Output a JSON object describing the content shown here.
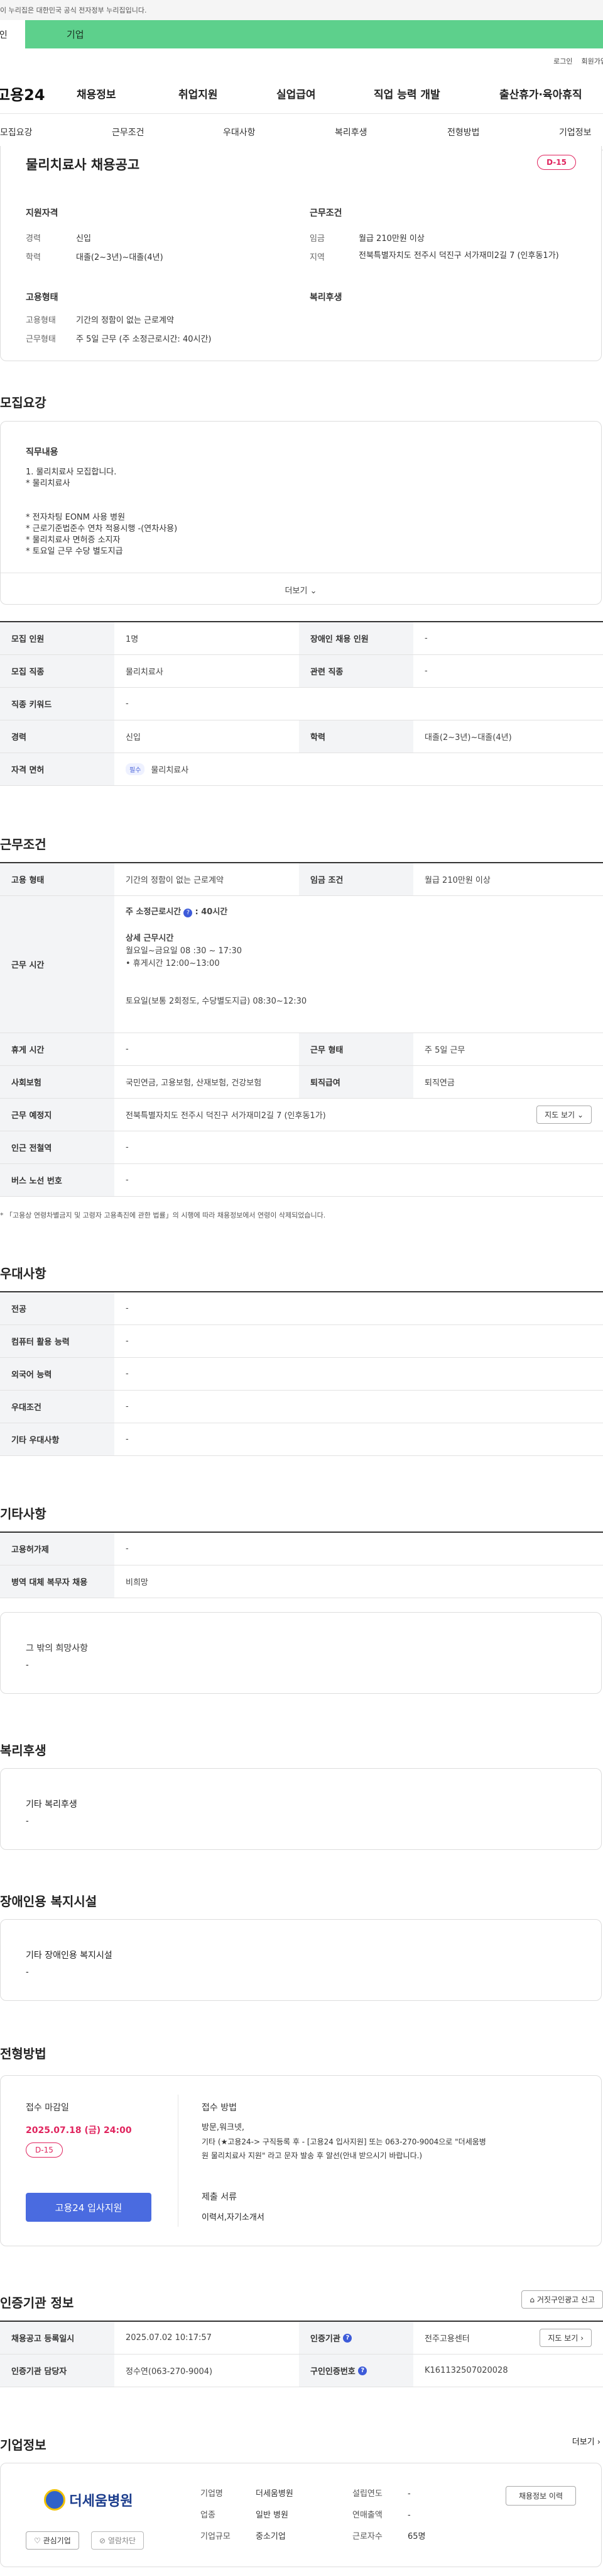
{
  "gov_notice": "이 누리집은 대한민국 공식 전자정부 누리집입니다.",
  "tabs": {
    "person": "개인",
    "business": "기업"
  },
  "util": {
    "login": "로그인",
    "join": "회원가입"
  },
  "logo": "고용24",
  "gnb": [
    "채용정보",
    "취업지원",
    "실업급여",
    "직업 능력 개발",
    "출산휴가·육아휴직"
  ],
  "anchors": [
    "모집요강",
    "근무조건",
    "우대사항",
    "복리후생",
    "전형방법",
    "기업정보"
  ],
  "summary": {
    "title": "물리치료사 채용공고",
    "dday": "D-15",
    "qual_title": "지원자격",
    "career_label": "경력",
    "career_value": "신입",
    "edu_label": "학력",
    "edu_value": "대졸(2~3년)~대졸(4년)",
    "cond_title": "근무조건",
    "wage_label": "임금",
    "wage_value": "월급 210만원 이상",
    "region_label": "지역",
    "region_value": "전북특별자치도 전주시 덕진구 서가재미2길 7 (인후동1가)",
    "emp_title": "고용형태",
    "emptype_label": "고용형태",
    "emptype_value": "기간의 정함이 없는 근로계약",
    "worktype_label": "근무형태",
    "worktype_value": "주 5일 근무 (주 소정근로시간: 40시간)",
    "welfare_title": "복리후생"
  },
  "recruit": {
    "title": "모집요강",
    "duty_title": "직무내용",
    "duty_lines": [
      "1. 물리치료사 모집합니다.",
      "* 물리치료사",
      "",
      "",
      "* 전자차팅 EONM 사용 병원",
      "* 근로기준법준수 연차 적용시행 -(연차사용)",
      "* 물리치료사 면허증 소지자",
      "* 토요일 근무 수당 별도지급"
    ],
    "more": "더보기",
    "t": {
      "count_label": "모집 인원",
      "count_value": "1명",
      "disabled_label": "장애인 채용 인원",
      "disabled_value": "-",
      "job_label": "모집 직종",
      "job_value": "물리치료사",
      "related_label": "관련 직종",
      "related_value": "-",
      "keyword_label": "직종 키워드",
      "keyword_value": "-",
      "career_label": "경력",
      "career_value": "신입",
      "edu_label": "학력",
      "edu_value": "대졸(2~3년)~대졸(4년)",
      "license_label": "자격 면허",
      "license_chip": "필수",
      "license_value": "물리치료사"
    }
  },
  "work": {
    "title": "근무조건",
    "emp_label": "고용 형태",
    "emp_value": "기간의 정함이 없는 근로계약",
    "wage_label": "임금 조건",
    "wage_value": "월급 210만원 이상",
    "hours_label": "근무 시간",
    "hours_week": "주 소정근로시간",
    "hours_week_value": ": 40시간",
    "hours_detail_title": "상세 근무시간",
    "hours_line1": "월요일~금요일  08 :30 ~ 17:30",
    "hours_line2": "• 휴게시간 12:00~13:00",
    "hours_line3": "토요일(보통 2회정도, 수당별도지급) 08:30~12:30",
    "break_label": "휴게 시간",
    "break_value": "-",
    "type_label": "근무 형태",
    "type_value": "주 5일 근무",
    "insurance_label": "사회보험",
    "insurance_value": "국민연금, 고용보험, 산재보험, 건강보험",
    "retire_label": "퇴직급여",
    "retire_value": "퇴직연금",
    "place_label": "근무 예정지",
    "place_value": "전북특별자치도 전주시 덕진구 서가재미2길 7 (인후동1가)",
    "map_btn": "지도 보기",
    "subway_label": "인근 전철역",
    "subway_value": "-",
    "bus_label": "버스 노선 번호",
    "bus_value": "-",
    "note": "* 「고용상 연령차별금지 및 고령자 고용촉진에 관한 법률」의 시행에 따라 채용정보에서 연령이 삭제되었습니다."
  },
  "pref": {
    "title": "우대사항",
    "rows": [
      {
        "label": "전공",
        "value": "-"
      },
      {
        "label": "컴퓨터 활용 능력",
        "value": "-"
      },
      {
        "label": "외국어 능력",
        "value": "-"
      },
      {
        "label": "우대조건",
        "value": "-"
      },
      {
        "label": "기타 우대사항",
        "value": "-"
      }
    ]
  },
  "etc": {
    "title": "기타사항",
    "rows": [
      {
        "label": "고용허가제",
        "value": "-"
      },
      {
        "label": "병역 대체 복무자 채용",
        "value": "비희망"
      }
    ],
    "hope_title": "그 밖의 희망사항",
    "hope_value": "-"
  },
  "welfare": {
    "title": "복리후생",
    "box_title": "기타 복리후생",
    "box_value": "-"
  },
  "disabled_fac": {
    "title": "장애인용 복지시설",
    "box_title": "기타 장애인용 복지시설",
    "box_value": "-"
  },
  "selection": {
    "title": "전형방법",
    "deadline_title": "접수 마감일",
    "deadline": "2025.07.18 (금) 24:00",
    "dday": "D-15",
    "apply_btn": "고용24 입사지원",
    "method_title": "접수 방법",
    "method_line1": "방문,워크넷,",
    "method_line2": "기타 (★고용24-> 구직등록 후 - [고용24 입사지원] 또는 063-270-9004으로 \"더세움병",
    "method_line3": "원 물리치료사 지원\" 라고 문자 발송 후 알선(안내 받으시기 바랍니다.)",
    "docs_title": "제출 서류",
    "docs_value": "이력서,자기소개서"
  },
  "cert": {
    "title": "인증기관 정보",
    "report_btn": "거짓구인광고 신고",
    "reg_label": "채용공고 등록일시",
    "reg_value": "2025.07.02 10:17:57",
    "org_label": "인증기관",
    "org_value": "전주고용센터",
    "map_btn": "지도 보기",
    "mgr_label": "인증기관 담당자",
    "mgr_value": "정수연(063-270-9004)",
    "auth_label": "구인인증번호",
    "auth_value": "K161132507020028"
  },
  "company": {
    "title": "기업정보",
    "more": "더보기",
    "logo_text": "더세움병원",
    "fav_btn": "관심기업",
    "block_btn": "열람차단",
    "history_btn": "채용정보 이력",
    "name_label": "기업명",
    "name_value": "더세움병원",
    "industry_label": "업종",
    "industry_value": "일반 병원",
    "scale_label": "기업규모",
    "scale_value": "중소기업",
    "year_label": "설립연도",
    "year_value": "-",
    "sales_label": "연매출액",
    "sales_value": "-",
    "emp_label": "근로자수",
    "emp_value": "65명"
  }
}
